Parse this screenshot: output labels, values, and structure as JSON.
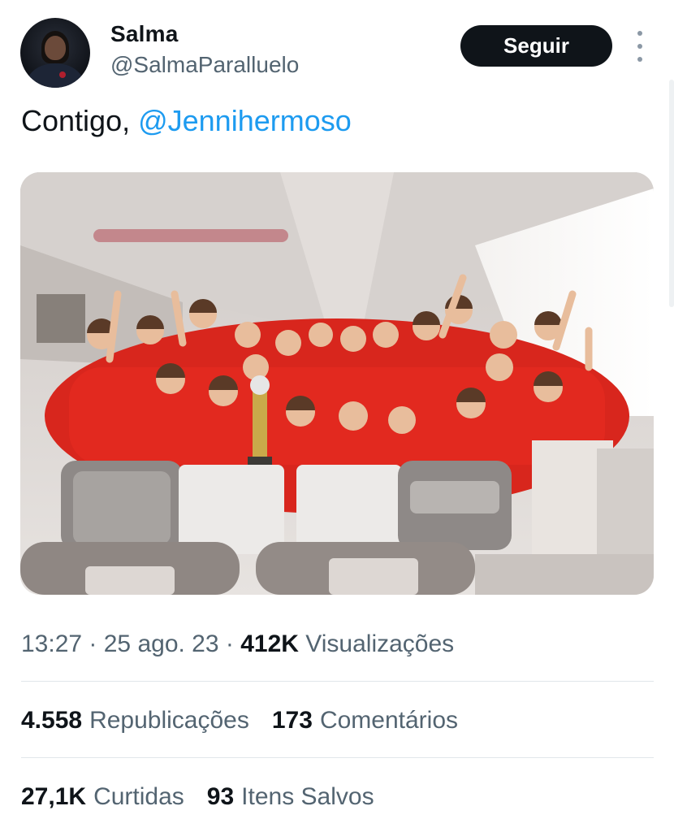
{
  "user": {
    "display_name": "Salma",
    "handle": "@SalmaParalluelo"
  },
  "follow_button": {
    "label": "Seguir"
  },
  "tweet": {
    "text_prefix": "Contigo, ",
    "mention": "@Jennihermoso"
  },
  "meta": {
    "time": "13:27",
    "separator_1": " · ",
    "date": "25 ago. 23",
    "separator_2": " · ",
    "views_count": "412K",
    "views_label": "Visualizações"
  },
  "stats": {
    "reposts_count": "4.558",
    "reposts_label": "Republicações",
    "comments_count": "173",
    "comments_label": "Comentários",
    "likes_count": "27,1K",
    "likes_label": "Curtidas",
    "saves_count": "93",
    "saves_label": "Itens Salvos"
  },
  "icons": {
    "more": "more-vertical-icon"
  },
  "colors": {
    "mention": "#1d9bf0",
    "button_bg": "#0f1419",
    "secondary_text": "#536471",
    "jersey_red": "#e8241c"
  }
}
